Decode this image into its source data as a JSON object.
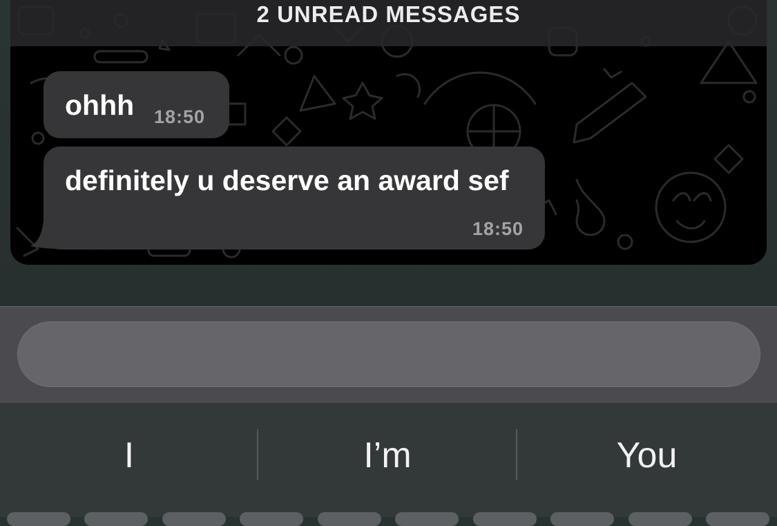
{
  "banner": {
    "unread_label": "2 UNREAD MESSAGES"
  },
  "messages": [
    {
      "text": "ohhh",
      "time": "18:50"
    },
    {
      "text": "definitely u deserve an award sef",
      "time": "18:50"
    }
  ],
  "composer": {
    "value": "",
    "placeholder": ""
  },
  "keyboard": {
    "suggestions": [
      "I",
      "I’m",
      "You"
    ]
  },
  "colors": {
    "bubble": "#363638",
    "wallpaper": "#000000",
    "input_bar": "#4b4b4f",
    "keyboard": "#333838"
  }
}
